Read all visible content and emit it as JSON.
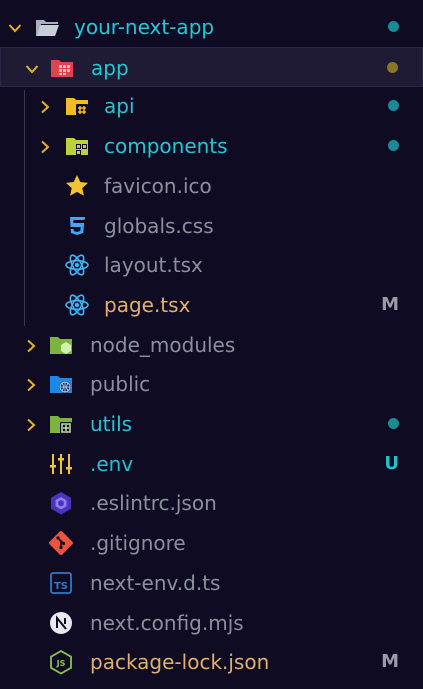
{
  "colors": {
    "background": "#0f0b23",
    "chevron": "#e6b422",
    "folder_label": "#22c8d6",
    "file_label": "#8e8f9c",
    "modified_label": "#e2b06a",
    "untracked_label": "#1fc2d1",
    "status_m": "#9c9aa8",
    "status_u": "#1fc2d1",
    "dot_teal": "#1a8a94",
    "dot_olive": "#8a7520"
  },
  "tree": {
    "items": [
      {
        "label": "your-next-app",
        "icon": "folder-open-icon",
        "chevron": "down",
        "depth": 0,
        "label_color": "#22c8d6",
        "status": "",
        "status_color": "",
        "dot": "#1a8a94"
      },
      {
        "label": "app",
        "icon": "app-folder-open-icon",
        "chevron": "down",
        "depth": 1,
        "label_color": "#22c8d6",
        "status": "",
        "status_color": "",
        "dot": "#8a7520",
        "selected": true
      },
      {
        "label": "api",
        "icon": "api-folder-icon",
        "chevron": "right",
        "depth": 2,
        "label_color": "#22c8d6",
        "status": "",
        "status_color": "",
        "dot": "#1a8a94"
      },
      {
        "label": "components",
        "icon": "components-folder-icon",
        "chevron": "right",
        "depth": 2,
        "label_color": "#22c8d6",
        "status": "",
        "status_color": "",
        "dot": "#1a8a94"
      },
      {
        "label": "favicon.ico",
        "icon": "star-icon",
        "chevron": "",
        "depth": 2,
        "label_color": "#8e8f9c",
        "status": "",
        "status_color": "",
        "dot": ""
      },
      {
        "label": "globals.css",
        "icon": "css-icon",
        "chevron": "",
        "depth": 2,
        "label_color": "#8e8f9c",
        "status": "",
        "status_color": "",
        "dot": ""
      },
      {
        "label": "layout.tsx",
        "icon": "react-icon",
        "chevron": "",
        "depth": 2,
        "label_color": "#8e8f9c",
        "status": "",
        "status_color": "",
        "dot": ""
      },
      {
        "label": "page.tsx",
        "icon": "react-icon",
        "chevron": "",
        "depth": 2,
        "label_color": "#e2b06a",
        "status": "M",
        "status_color": "#9c9aa8",
        "dot": ""
      },
      {
        "label": "node_modules",
        "icon": "node-folder-icon",
        "chevron": "right",
        "depth": 1,
        "label_color": "#8e8f9c",
        "status": "",
        "status_color": "",
        "dot": ""
      },
      {
        "label": "public",
        "icon": "public-folder-icon",
        "chevron": "right",
        "depth": 1,
        "label_color": "#8e8f9c",
        "status": "",
        "status_color": "",
        "dot": ""
      },
      {
        "label": "utils",
        "icon": "utils-folder-icon",
        "chevron": "right",
        "depth": 1,
        "label_color": "#22c8d6",
        "status": "",
        "status_color": "",
        "dot": "#1a8a94"
      },
      {
        "label": ".env",
        "icon": "env-icon",
        "chevron": "",
        "depth": 1,
        "label_color": "#1fc2d1",
        "status": "U",
        "status_color": "#1fc2d1",
        "dot": ""
      },
      {
        "label": ".eslintrc.json",
        "icon": "eslint-icon",
        "chevron": "",
        "depth": 1,
        "label_color": "#8e8f9c",
        "status": "",
        "status_color": "",
        "dot": ""
      },
      {
        "label": ".gitignore",
        "icon": "git-icon",
        "chevron": "",
        "depth": 1,
        "label_color": "#8e8f9c",
        "status": "",
        "status_color": "",
        "dot": ""
      },
      {
        "label": "next-env.d.ts",
        "icon": "typescript-icon",
        "chevron": "",
        "depth": 1,
        "label_color": "#8e8f9c",
        "status": "",
        "status_color": "",
        "dot": ""
      },
      {
        "label": "next.config.mjs",
        "icon": "next-icon",
        "chevron": "",
        "depth": 1,
        "label_color": "#8e8f9c",
        "status": "",
        "status_color": "",
        "dot": ""
      },
      {
        "label": "package-lock.json",
        "icon": "nodejs-icon",
        "chevron": "",
        "depth": 1,
        "label_color": "#e2b06a",
        "status": "M",
        "status_color": "#9c9aa8",
        "dot": ""
      }
    ]
  }
}
